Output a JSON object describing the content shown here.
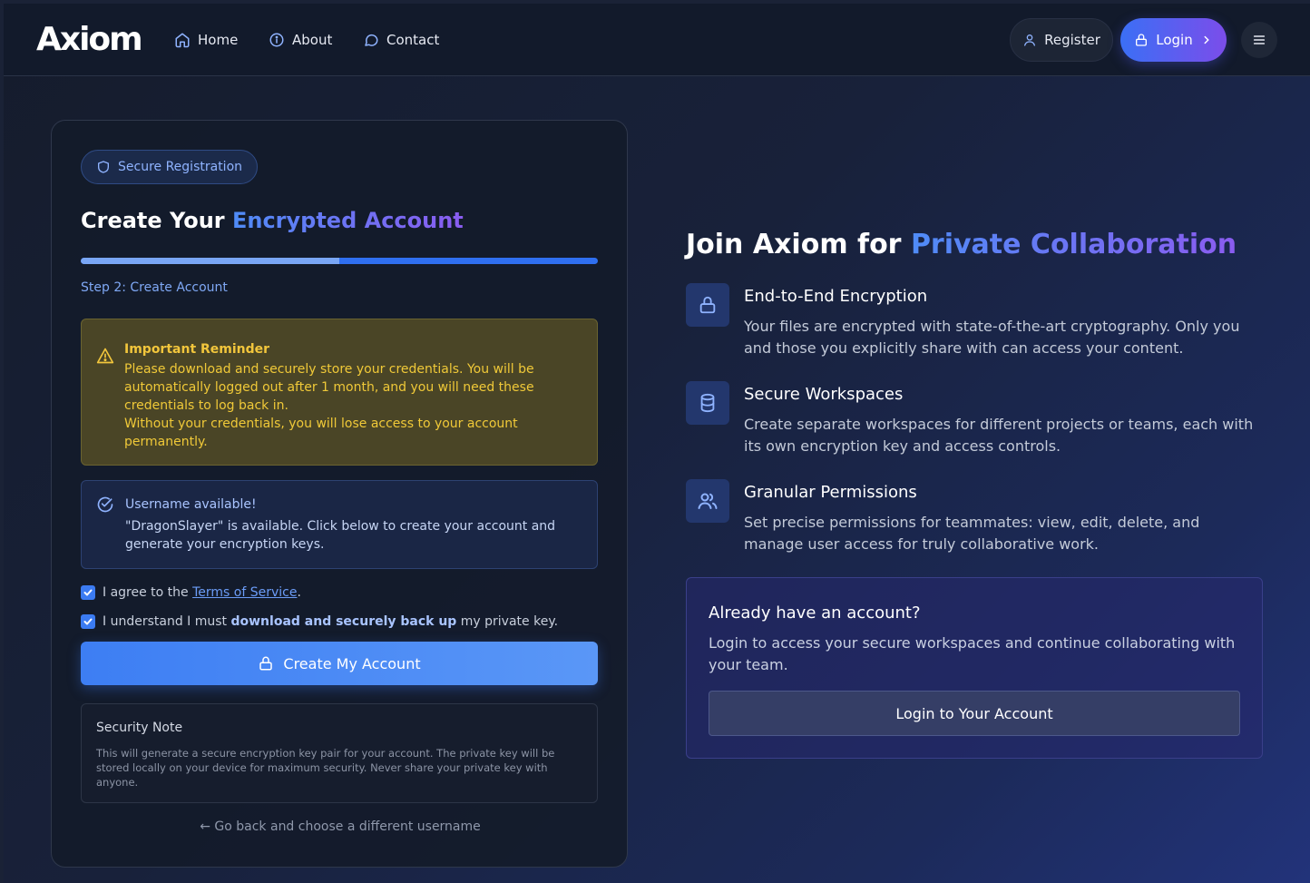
{
  "header": {
    "logo": "Axiom",
    "nav": [
      {
        "label": "Home",
        "icon": "home-icon"
      },
      {
        "label": "About",
        "icon": "info-icon"
      },
      {
        "label": "Contact",
        "icon": "chat-bubble-icon"
      }
    ],
    "register_label": "Register",
    "login_label": "Login"
  },
  "form": {
    "badge": "Secure Registration",
    "title_plain": "Create Your ",
    "title_accent": "Encrypted Account",
    "progress": 0.5,
    "step": "Step 2: Create Account",
    "warning": {
      "title": "Important Reminder",
      "body1": "Please download and securely store your credentials. You will be automatically logged out after 1 month, and you will need these credentials to log back in.",
      "body2": "Without your credentials, you will lose access to your account permanently."
    },
    "availability": {
      "title": "Username available!",
      "body": "\"DragonSlayer\" is available. Click below to create your account and generate your encryption keys."
    },
    "agree_prefix": "I agree to the ",
    "agree_link": "Terms of Service",
    "agree_suffix": ".",
    "understand_prefix": "I understand I must ",
    "understand_bold": "download and securely back up",
    "understand_suffix": " my private key.",
    "create_button": "Create My Account",
    "security_note": {
      "title": "Security Note",
      "body": "This will generate a secure encryption key pair for your account. The private key will be stored locally on your device for maximum security. Never share your private key with anyone."
    },
    "go_back": "← Go back and choose a different username"
  },
  "promo": {
    "title_plain": "Join Axiom for ",
    "title_accent": "Private Collaboration",
    "features": [
      {
        "icon": "lock-icon",
        "title": "End-to-End Encryption",
        "body": "Your files are encrypted with state-of-the-art cryptography. Only you and those you explicitly share with can access your content."
      },
      {
        "icon": "database-icon",
        "title": "Secure Workspaces",
        "body": "Create separate workspaces for different projects or teams, each with its own encryption key and access controls."
      },
      {
        "icon": "users-icon",
        "title": "Granular Permissions",
        "body": "Set precise permissions for teammates: view, edit, delete, and manage user access for truly collaborative work."
      }
    ],
    "already": {
      "title": "Already have an account?",
      "body": "Login to access your secure workspaces and continue collaborating with your team.",
      "button": "Login to Your Account"
    }
  }
}
